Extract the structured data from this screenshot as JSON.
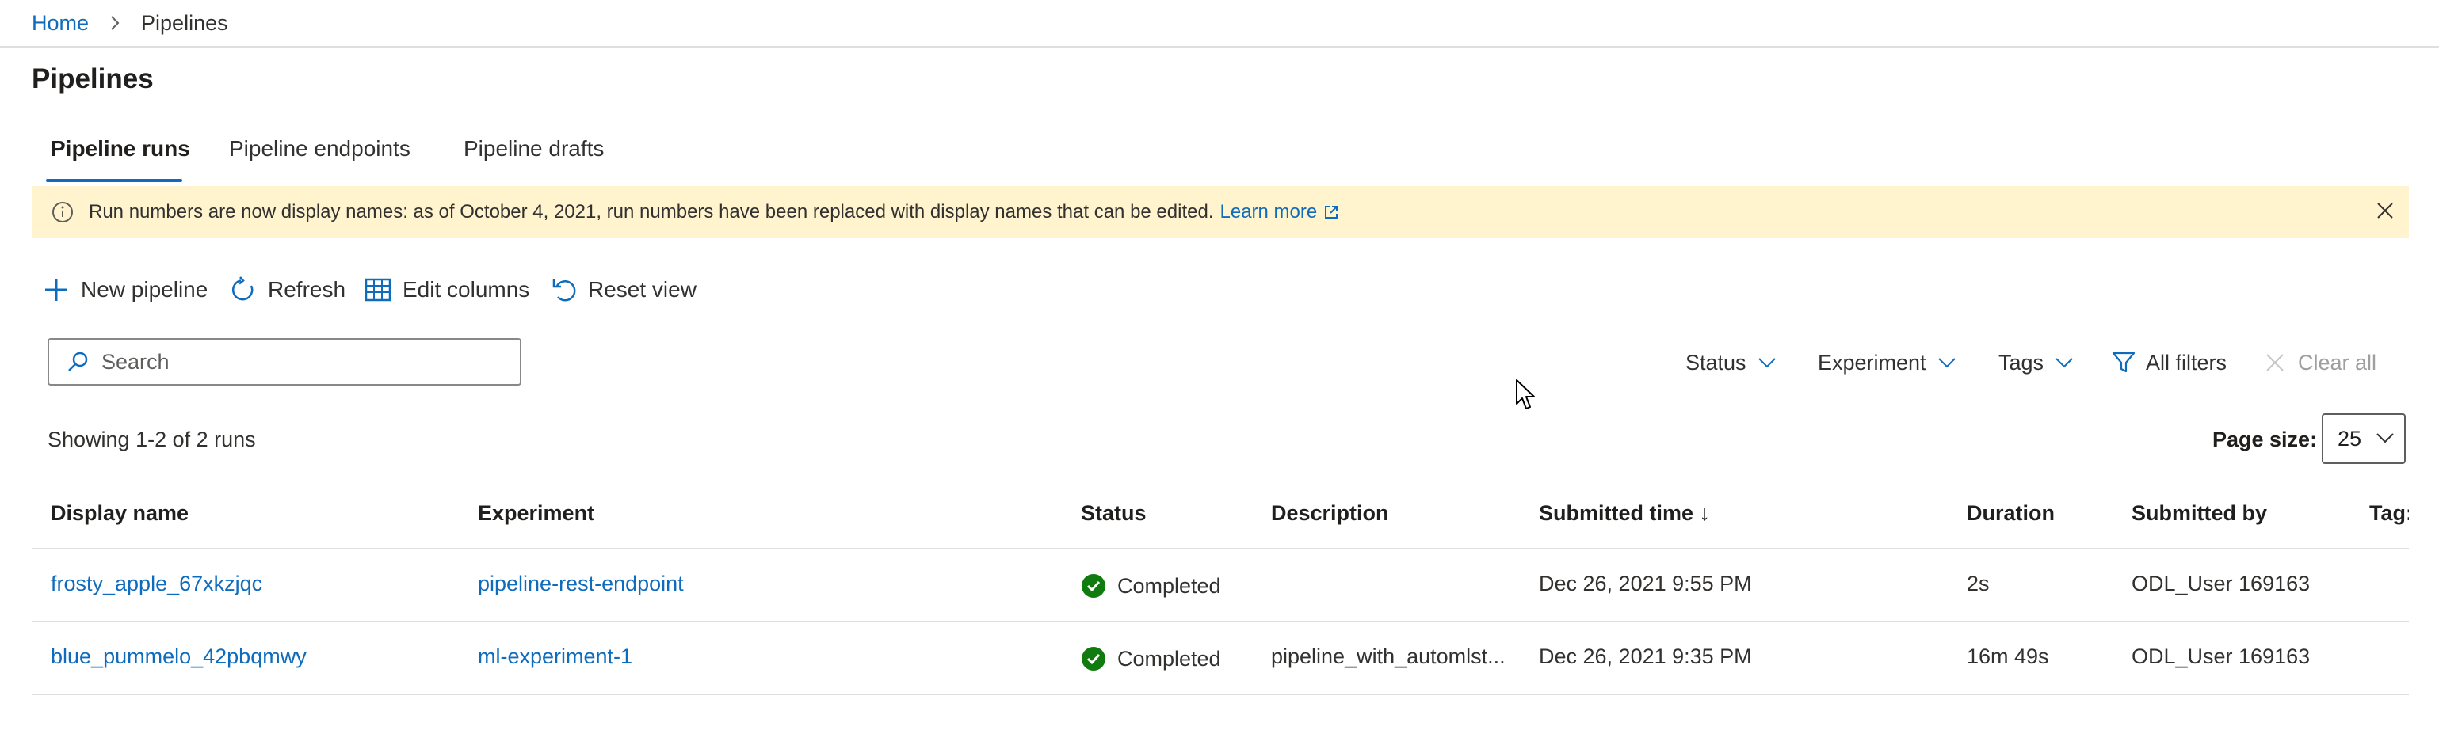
{
  "breadcrumb": {
    "home": "Home",
    "current": "Pipelines"
  },
  "page": {
    "title": "Pipelines"
  },
  "tabs": [
    {
      "label": "Pipeline runs",
      "active": true
    },
    {
      "label": "Pipeline endpoints",
      "active": false
    },
    {
      "label": "Pipeline drafts",
      "active": false
    }
  ],
  "banner": {
    "message": "Run numbers are now display names: as of October 4, 2021, run numbers have been replaced with display names that can be edited.",
    "link": "Learn more"
  },
  "toolbar": {
    "new_pipeline": "New pipeline",
    "refresh": "Refresh",
    "edit_columns": "Edit columns",
    "reset_view": "Reset view"
  },
  "search": {
    "placeholder": "Search"
  },
  "filters": {
    "status": "Status",
    "experiment": "Experiment",
    "tags": "Tags",
    "all_filters": "All filters",
    "clear_all": "Clear all"
  },
  "summary": {
    "showing": "Showing 1-2 of 2 runs"
  },
  "pagination": {
    "label": "Page size:",
    "value": "25"
  },
  "table": {
    "columns": {
      "display_name": "Display name",
      "experiment": "Experiment",
      "status": "Status",
      "description": "Description",
      "submitted_time": "Submitted time ↓",
      "duration": "Duration",
      "submitted_by": "Submitted by",
      "tags": "Tag:"
    },
    "rows": [
      {
        "display_name": "frosty_apple_67xkzjqc",
        "experiment": "pipeline-rest-endpoint",
        "status": "Completed",
        "description": "",
        "submitted_time": "Dec 26, 2021 9:55 PM",
        "duration": "2s",
        "submitted_by": "ODL_User 169163"
      },
      {
        "display_name": "blue_pummelo_42pbqmwy",
        "experiment": "ml-experiment-1",
        "status": "Completed",
        "description": "pipeline_with_automlst...",
        "submitted_time": "Dec 26, 2021 9:35 PM",
        "duration": "16m 49s",
        "submitted_by": "ODL_User 169163"
      }
    ]
  },
  "colors": {
    "accent": "#0f6cbd",
    "success": "#107c10",
    "banner_bg": "#fff4ce"
  }
}
